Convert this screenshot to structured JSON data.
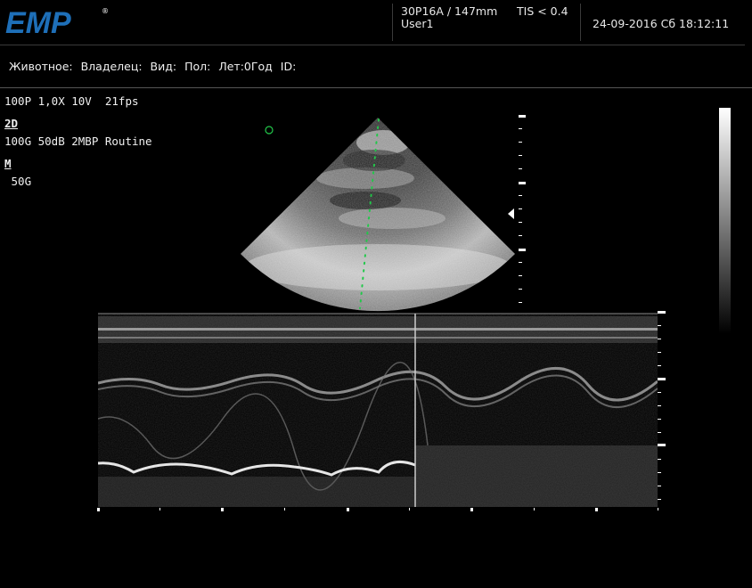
{
  "header": {
    "logo_text": "EMP",
    "logo_mark": "®",
    "probe": "30P16A / 147mm",
    "tis": "TIS < 0.4",
    "user": "User1",
    "datetime": "24-09-2016 Сб 18:12:11"
  },
  "patient_bar": {
    "animal": "Животное:",
    "owner": "Владелец:",
    "species": "Вид:",
    "sex": "Пол:",
    "age": "Лет:0Год",
    "id": "ID:"
  },
  "params": {
    "line1": "100P 1,0X 10V  21fps",
    "mode_2d": "2D",
    "line2": "100G 50dB 2MBP Routine",
    "mode_m": "M",
    "line3": " 50G"
  },
  "colors": {
    "accent": "#1e6fb8",
    "cursor_line": "#22c84a",
    "focus_marker": "#22c84a"
  }
}
